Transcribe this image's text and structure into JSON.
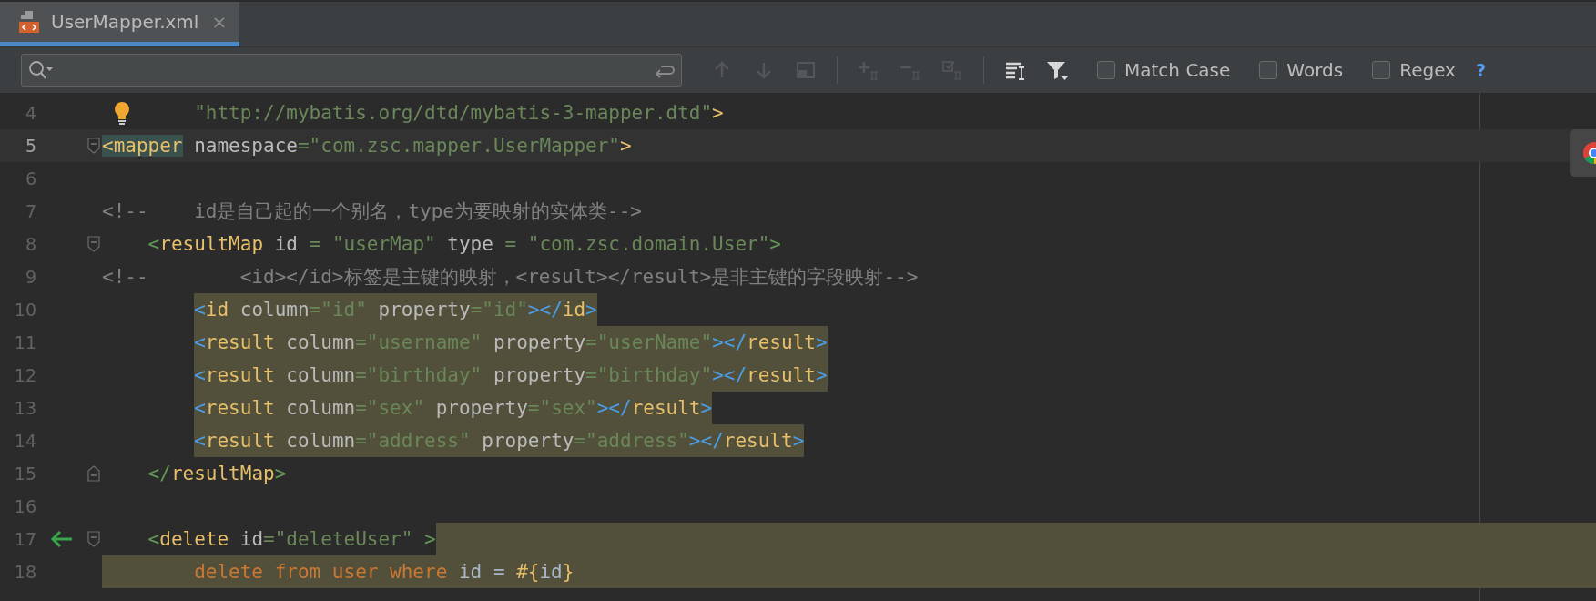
{
  "tabs": [
    {
      "label": "UserMapper.xml",
      "close": "×",
      "selected": true
    }
  ],
  "find_bar": {
    "tools": [
      {
        "kind": "prev",
        "disabled": true
      },
      {
        "kind": "next",
        "disabled": true
      },
      {
        "kind": "context",
        "disabled": true
      },
      {
        "kind": "separator"
      },
      {
        "kind": "add",
        "disabled": true
      },
      {
        "kind": "remove",
        "disabled": true
      },
      {
        "kind": "selectall",
        "disabled": true
      },
      {
        "kind": "separator"
      },
      {
        "kind": "lines",
        "disabled": false
      },
      {
        "kind": "filter",
        "disabled": false
      }
    ],
    "options": [
      {
        "label": "Match Case",
        "checked": false
      },
      {
        "label": "Words",
        "checked": false
      },
      {
        "label": "Regex",
        "checked": false
      }
    ],
    "help": "?"
  },
  "editor": {
    "lines": [
      {
        "number": "4",
        "current": false,
        "highlighted": false,
        "gutter_icon": {
          "kind": "bulb"
        },
        "tokens": [
          {
            "kind": "string",
            "text": "        \"http://mybatis.org/dtd/mybatis-3-mapper.dtd\""
          },
          {
            "kind": "tag",
            "text": ">"
          }
        ]
      },
      {
        "number": "5",
        "current": true,
        "highlighted": false,
        "fold": {
          "kind": "start"
        },
        "tokens": [
          {
            "kind": "tag",
            "text": "<mapper",
            "matched": true
          },
          {
            "kind": "attr",
            "text": " namespace"
          },
          {
            "kind": "string",
            "text": "=\"com.zsc.mapper.UserMapper\""
          },
          {
            "kind": "tag",
            "text": ">"
          }
        ]
      },
      {
        "number": "6",
        "current": false
      },
      {
        "number": "7",
        "current": false,
        "highlighted": false,
        "tokens": [
          {
            "kind": "comment",
            "text": "<!--    id是自己起的一个别名，type为要映射的实体类-->"
          }
        ]
      },
      {
        "number": "8",
        "current": false,
        "highlighted": false,
        "fold": {
          "kind": "start"
        },
        "tokens": [
          {
            "kind": "bracket",
            "text": "    <"
          },
          {
            "kind": "tag",
            "text": "resultMap"
          },
          {
            "kind": "attr",
            "text": " id "
          },
          {
            "kind": "string",
            "text": "= \"userMap\""
          },
          {
            "kind": "attr",
            "text": " type "
          },
          {
            "kind": "string",
            "text": "= \"com.zsc.domain.User\""
          },
          {
            "kind": "bracket",
            "text": ">"
          }
        ]
      },
      {
        "number": "9",
        "current": false,
        "highlighted": false,
        "tokens": [
          {
            "kind": "comment",
            "text": "<!--        <id></id>标签是主键的映射，<result></result>是非主键的字段映射-->"
          }
        ]
      },
      {
        "number": "10",
        "current": false,
        "highlighted": true,
        "tokens": [
          {
            "kind": "brace",
            "text": "        <"
          },
          {
            "kind": "tag",
            "text": "id"
          },
          {
            "kind": "attr",
            "text": " column"
          },
          {
            "kind": "string",
            "text": "=\"id\""
          },
          {
            "kind": "attr",
            "text": " property"
          },
          {
            "kind": "string",
            "text": "=\"id\""
          },
          {
            "kind": "brace",
            "text": "></"
          },
          {
            "kind": "tag",
            "text": "id"
          },
          {
            "kind": "brace",
            "text": ">"
          }
        ]
      },
      {
        "number": "11",
        "current": false,
        "highlighted": true,
        "tokens": [
          {
            "kind": "brace",
            "text": "        <"
          },
          {
            "kind": "tag",
            "text": "result"
          },
          {
            "kind": "attr",
            "text": " column"
          },
          {
            "kind": "string",
            "text": "=\"username\""
          },
          {
            "kind": "attr",
            "text": " property"
          },
          {
            "kind": "string",
            "text": "=\"userName\""
          },
          {
            "kind": "brace",
            "text": "></"
          },
          {
            "kind": "tag",
            "text": "result"
          },
          {
            "kind": "brace",
            "text": ">"
          }
        ]
      },
      {
        "number": "12",
        "current": false,
        "highlighted": true,
        "tokens": [
          {
            "kind": "brace",
            "text": "        <"
          },
          {
            "kind": "tag",
            "text": "result"
          },
          {
            "kind": "attr",
            "text": " column"
          },
          {
            "kind": "string",
            "text": "=\"birthday\""
          },
          {
            "kind": "attr",
            "text": " property"
          },
          {
            "kind": "string",
            "text": "=\"birthday\""
          },
          {
            "kind": "brace",
            "text": "></"
          },
          {
            "kind": "tag",
            "text": "result"
          },
          {
            "kind": "brace",
            "text": ">"
          }
        ]
      },
      {
        "number": "13",
        "current": false,
        "highlighted": true,
        "tokens": [
          {
            "kind": "brace",
            "text": "        <"
          },
          {
            "kind": "tag",
            "text": "result"
          },
          {
            "kind": "attr",
            "text": " column"
          },
          {
            "kind": "string",
            "text": "=\"sex\""
          },
          {
            "kind": "attr",
            "text": " property"
          },
          {
            "kind": "string",
            "text": "=\"sex\""
          },
          {
            "kind": "brace",
            "text": "></"
          },
          {
            "kind": "tag",
            "text": "result"
          },
          {
            "kind": "brace",
            "text": ">"
          }
        ]
      },
      {
        "number": "14",
        "current": false,
        "highlighted": true,
        "tokens": [
          {
            "kind": "brace",
            "text": "        <"
          },
          {
            "kind": "tag",
            "text": "result"
          },
          {
            "kind": "attr",
            "text": " column"
          },
          {
            "kind": "string",
            "text": "=\"address\""
          },
          {
            "kind": "attr",
            "text": " property"
          },
          {
            "kind": "string",
            "text": "=\"address\""
          },
          {
            "kind": "brace",
            "text": "></"
          },
          {
            "kind": "tag",
            "text": "result"
          },
          {
            "kind": "brace",
            "text": ">"
          }
        ]
      },
      {
        "number": "15",
        "current": false,
        "highlighted": false,
        "fold": {
          "kind": "end"
        },
        "tokens": [
          {
            "kind": "bracket",
            "text": "    </"
          },
          {
            "kind": "tag",
            "text": "resultMap"
          },
          {
            "kind": "bracket",
            "text": ">"
          }
        ]
      },
      {
        "number": "16",
        "current": false
      },
      {
        "number": "17",
        "current": false,
        "highlighted": false,
        "selection": {
          "kind": "tail"
        },
        "gutter_icon": {
          "kind": "arrow"
        },
        "fold": {
          "kind": "start"
        },
        "tokens": [
          {
            "kind": "bracket",
            "text": "    <"
          },
          {
            "kind": "tag",
            "text": "delete"
          },
          {
            "kind": "attr",
            "text": " id"
          },
          {
            "kind": "string",
            "text": "=\"deleteUser\""
          },
          {
            "kind": "bracket",
            "text": " >"
          }
        ]
      },
      {
        "number": "18",
        "current": false,
        "selection": {
          "kind": "full"
        },
        "tokens": [
          {
            "kind": "keyword",
            "text": "        delete from user where"
          },
          {
            "kind": "text",
            "text": " id = "
          },
          {
            "kind": "tag",
            "text": "#{"
          },
          {
            "kind": "text",
            "text": "id"
          },
          {
            "kind": "tag",
            "text": "}"
          }
        ]
      }
    ]
  }
}
